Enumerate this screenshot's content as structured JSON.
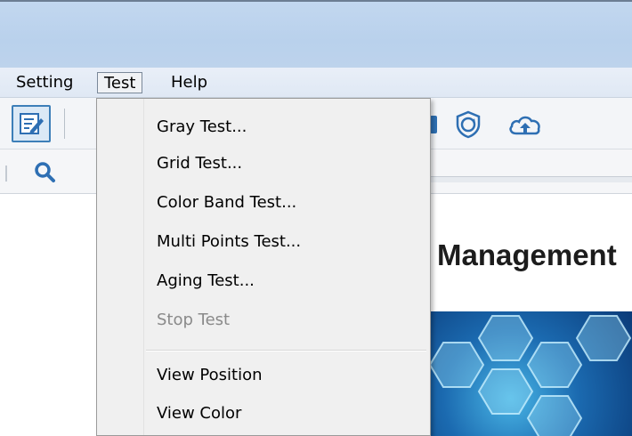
{
  "menubar": {
    "items": [
      {
        "label": "Setting"
      },
      {
        "label": "Test"
      },
      {
        "label": "Help"
      }
    ]
  },
  "toolbar": {
    "icons": [
      "edit-icon",
      "shield-icon",
      "cloud-upload-icon"
    ]
  },
  "subbar": {
    "icons": [
      "search-icon"
    ]
  },
  "test_menu": {
    "items": [
      {
        "label": "Gray Test...",
        "enabled": true
      },
      {
        "label": "Grid Test...",
        "enabled": true
      },
      {
        "label": "Color Band Test...",
        "enabled": true
      },
      {
        "label": "Multi Points Test...",
        "enabled": true
      },
      {
        "label": "Aging Test...",
        "enabled": true
      },
      {
        "label": "Stop Test",
        "enabled": false
      },
      {
        "label": "View Position",
        "enabled": true
      },
      {
        "label": "View Color",
        "enabled": true
      }
    ]
  },
  "content": {
    "title": "Management"
  },
  "colors": {
    "accent": "#2e6fb3",
    "titlebar": "#c2d7ef",
    "menu_bg": "#f0f0f0",
    "disabled_text": "#8a8a8a"
  }
}
